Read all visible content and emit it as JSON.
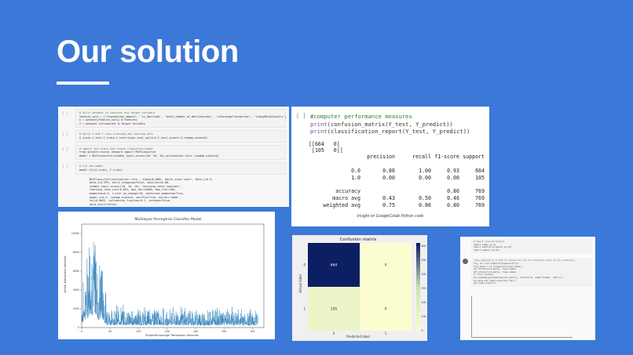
{
  "slide": {
    "title": "Our solution",
    "colors": {
      "background": "#3b78d8",
      "title": "#ffffff"
    }
  },
  "code_panel": {
    "cells": [
      {
        "gutter": "[ ]",
        "lines": [
          {
            "text": "# Split dataset in features and target variable",
            "kind": "comment"
          },
          {
            "text": "feature_cols = ['transaction_amount', 'is_declined', 'total_number_of_declines/day', 'isForeignTransaction', 'isHighRiskCountry']",
            "kind": "code"
          },
          {
            "text": "X = dataset[feature_cols] # Features",
            "kind": "code"
          },
          {
            "text": "Y = dataset.isFradulent # Target variable",
            "kind": "code"
          }
        ]
      },
      {
        "gutter": "[ ]",
        "lines": [
          {
            "text": "# Split X and Y into training and testing sets",
            "kind": "comment"
          },
          {
            "text": "X_train,X_test,Y_train,Y_test=train_test_split(X,Y,test_size=0.3,random_state=0)",
            "kind": "code"
          }
        ]
      },
      {
        "gutter": "[ ]",
        "lines": [
          {
            "text": "# import the class and create classifier/model",
            "kind": "comment"
          },
          {
            "text": "from sklearn.neural_network import MLPClassifier",
            "kind": "code"
          },
          {
            "text": "model = MLPClassifier(hidden_layer_sizes=(10, 10, 10),activation='relu',random_state=0)",
            "kind": "code"
          }
        ]
      },
      {
        "gutter": "[ ]",
        "lines": [
          {
            "text": "# Fit the model",
            "kind": "comment"
          },
          {
            "text": "model.fit(X_train, Y_train)",
            "kind": "code"
          }
        ]
      }
    ],
    "output_lines": [
      "MLPClassifier(activation='relu', alpha=0.0001, batch_size='auto', beta_1=0.9,",
      "       beta_2=0.999, early_stopping=False, epsilon=1e-08,",
      "       hidden_layer_sizes=(10, 10, 10), learning_rate='constant',",
      "       learning_rate_init=0.001, max_fun=15000, max_iter=200,",
      "       momentum=0.9, n_iter_no_change=10, nesterovs_momentum=True,",
      "       power_t=0.5, random_state=0, shuffle=True, solver='adam',",
      "       tol=0.0001, validation_fraction=0.1, verbose=False,",
      "       warm_start=False)"
    ]
  },
  "chart_panel": {
    "chart_data": {
      "type": "line",
      "title": "Multilayer Perceptron Classifier Model",
      "xlabel": "Projected Average Transaction Amounts",
      "ylabel": "Actual Transaction Amounts",
      "xlim": [
        0,
        320
      ],
      "ylim": [
        0,
        11000
      ],
      "xticks": [
        0,
        50,
        100,
        150,
        200,
        250,
        300
      ],
      "yticks": [
        0,
        2000,
        4000,
        6000,
        8000,
        10000
      ],
      "color": "#1f77b4",
      "series": [
        {
          "x": [
            0,
            10,
            15,
            20,
            25,
            30,
            35,
            40,
            45,
            50,
            60,
            80,
            100,
            120,
            150,
            180,
            200,
            230,
            260,
            290,
            310
          ],
          "y": [
            2500,
            6000,
            10500,
            7500,
            9000,
            4500,
            6500,
            3500,
            1800,
            1500,
            1800,
            1600,
            1500,
            1700,
            1500,
            1600,
            1400,
            1500,
            1600,
            1400,
            1500
          ]
        }
      ]
    }
  },
  "perf_panel": {
    "gutter": "[ ]",
    "code": [
      {
        "text": "#computer performance measures",
        "kind": "comment"
      },
      {
        "text": "print(confusion_matrix(Y_test, Y_predict))",
        "kind": "code"
      },
      {
        "text": "print(classification_report(Y_test, Y_predict))",
        "kind": "code"
      }
    ],
    "matrix_lines": [
      "[[664   0]",
      " [105   0]]"
    ],
    "report": {
      "headers": [
        "precision",
        "recall",
        "f1-score",
        "support"
      ],
      "rows": [
        {
          "label": "0.0",
          "values": [
            "0.86",
            "1.00",
            "0.93",
            "664"
          ]
        },
        {
          "label": "1.0",
          "values": [
            "0.00",
            "0.00",
            "0.00",
            "105"
          ]
        },
        {
          "label": "accuracy",
          "values": [
            "",
            "",
            "0.86",
            "769"
          ]
        },
        {
          "label": "macro avg",
          "values": [
            "0.43",
            "0.50",
            "0.46",
            "769"
          ]
        },
        {
          "label": "weighted avg",
          "values": [
            "0.75",
            "0.86",
            "0.80",
            "769"
          ]
        }
      ]
    },
    "caption": "Insight on GoogleColab Python code"
  },
  "confusion_panel": {
    "chart_data": {
      "type": "heatmap",
      "title": "Confusion matrix",
      "xlabel": "Predicted label",
      "ylabel": "Actual label",
      "x_ticks": [
        "0",
        "1"
      ],
      "y_ticks": [
        "0",
        "1"
      ],
      "cells": [
        [
          664,
          0
        ],
        [
          105,
          0
        ]
      ],
      "colorbar_ticks": [
        "600",
        "500",
        "400",
        "300",
        "200",
        "100",
        "0"
      ],
      "colors": {
        "high": "#0d1f63",
        "mid": "#c9e4b4",
        "low": "#fbfdd0"
      }
    }
  },
  "notebook_panel": {
    "cell1": [
      {
        "text": "# import required modules",
        "kind": "comment"
      },
      {
        "text": "import numpy as np",
        "kind": "code"
      },
      {
        "text": "import matplotlib.pyplot as plt",
        "kind": "code"
      },
      {
        "text": "import seaborn as sns",
        "kind": "code"
      }
    ],
    "cell2": [
      {
        "text": "class_names=[0,1] # name  of classes %in are not fraudulent while 1% are fraudulent",
        "kind": "comment"
      },
      {
        "text": "fig, ax = plt.subplots(figsize=(6,5))",
        "kind": "code"
      },
      {
        "text": "tick_marks = np.arange(len(class_names))",
        "kind": "code"
      },
      {
        "text": "plt.xticks(tick_marks, class_names)",
        "kind": "code"
      },
      {
        "text": "plt.yticks(tick_marks, class_names)",
        "kind": "code"
      },
      {
        "text": "# create heatmap",
        "kind": "comment"
      },
      {
        "text": "sns.heatmap(pd.DataFrame(cnf_matrix), annot=True, cmap=\"YlGnBu\" ,fmt='g')",
        "kind": "code"
      },
      {
        "text": "ax.xaxis.set_label_position(\"top\")",
        "kind": "code"
      },
      {
        "text": "plt.tight_layout()",
        "kind": "code"
      }
    ]
  }
}
